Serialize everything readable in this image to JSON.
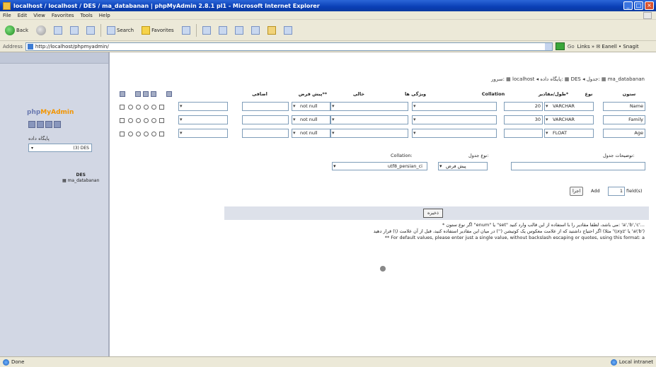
{
  "window": {
    "title": "localhost / localhost / DES / ma_databanan | phpMyAdmin 2.8.1 pl1 - Microsoft Internet Explorer"
  },
  "menu": [
    "File",
    "Edit",
    "View",
    "Favorites",
    "Tools",
    "Help"
  ],
  "toolbar": {
    "back_label": "Back",
    "search_label": "Search",
    "favorites_label": "Favorites"
  },
  "address": {
    "label": "Address",
    "url": "http://localhost/phpmyadmin/",
    "go_label": "Go",
    "links_label": "Links »  ✉ Eanell  •  Snagit"
  },
  "sidebar": {
    "logo_a": "php",
    "logo_b": "MyAdmin",
    "db_label": "پایگاه داده",
    "db_value": "(3) DES",
    "table_title": "DES",
    "table_item": "▦ ma_databanan"
  },
  "breadcrumb": {
    "text": "سرور: ▦ localhost ◂ پایگاه داده: ▦ DES ◂ جدول: ▦ ma_databanan"
  },
  "table": {
    "headers": [
      "ستون",
      "نوع",
      "طول/مقادیر*",
      "Collation",
      "ویژگی ها",
      "خالی",
      "پیش فرض**",
      "اضافی"
    ],
    "rows": [
      {
        "name": "Name",
        "type": "VARCHAR",
        "length": "20",
        "null": "not null"
      },
      {
        "name": "Family",
        "type": "VARCHAR",
        "length": "30",
        "null": "not null"
      },
      {
        "name": "Age",
        "type": "FLOAT",
        "length": "",
        "null": "not null"
      }
    ]
  },
  "table_options": {
    "comments_label": "توضیحات جدول:",
    "type_label": "نوع جدول:",
    "type_value": "پیش فرض",
    "collation_label": "Collation:",
    "collation_value": "utf8_persian_ci"
  },
  "add_fields": {
    "add_label": "Add",
    "count": "1",
    "fields_label": "field(s)",
    "go_label": "اجرا"
  },
  "save_label": "ذخیره",
  "notes": [
    "* اگر نوع ستون \"enum\" یا \"set\" می باشد، لطفا مقادیر را با استفاده از این قالب وارد کنید: 'a','b','c'...",
    "اگر احتیاج داشتید که از علامت معکوس یک کوتیشن ('') در میان این مقادیر استفاده کنید، قبل از آن علامت (\\) قرار دهید (مثلا '\\\\xyz' یا 'a\\'b')",
    "** For default values, please enter just a single value, without backslash escaping or quotes, using this format: a"
  ],
  "status": {
    "left": "Done",
    "zone": "Local intranet"
  }
}
